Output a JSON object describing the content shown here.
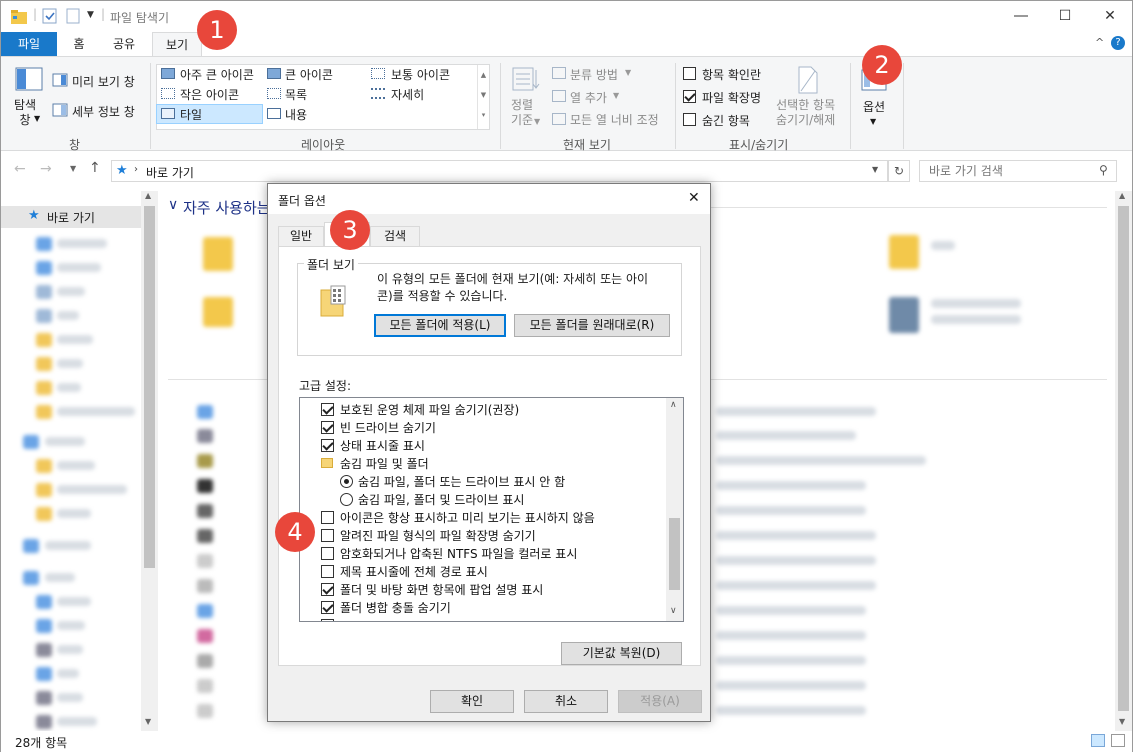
{
  "window": {
    "title": "파일 탐색기",
    "status": "28개 항목"
  },
  "tabs": [
    {
      "label": "파일"
    },
    {
      "label": "홈"
    },
    {
      "label": "공유"
    },
    {
      "label": "보기"
    }
  ],
  "ribbon": {
    "pane": {
      "nav_pane_label": "탐색\n창",
      "preview": "미리 보기 창",
      "details": "세부 정보 창",
      "group": "창"
    },
    "layout": {
      "items": [
        "아주 큰 아이콘",
        "큰 아이콘",
        "보통 아이콘",
        "작은 아이콘",
        "목록",
        "자세히",
        "타일",
        "내용"
      ],
      "group": "레이아웃"
    },
    "current_view": {
      "sort": "정렬\n기준",
      "group_by": "분류 방법",
      "add_column": "열 추가",
      "fit_columns": "모든 열 너비 조정",
      "group": "현재 보기"
    },
    "show_hide": {
      "item_checkbox": "항목 확인란",
      "file_ext": "파일 확장명",
      "hidden_items": "숨긴 항목",
      "hide_selected": "선택한 항목\n숨기기/해제",
      "group": "표시/숨기기"
    },
    "options": "옵션"
  },
  "address": {
    "path": "바로 가기",
    "search_placeholder": "바로 가기 검색"
  },
  "nav": {
    "quick_access": "바로 가기"
  },
  "content": {
    "frequent_header": "자주 사용하는"
  },
  "dialog": {
    "title": "폴더 옵션",
    "tabs": [
      "일반",
      "보기",
      "검색"
    ],
    "folder_view": {
      "legend": "폴더 보기",
      "desc": "이 유형의 모든 폴더에 현재 보기(예: 자세히 또는 아이\n콘)를 적용할 수 있습니다.",
      "apply_all": "모든 폴더에 적용(L)",
      "reset_all": "모든 폴더를 원래대로(R)"
    },
    "advanced_label": "고급 설정:",
    "settings": [
      {
        "label": "보호된 운영 체제 파일 숨기기(권장)",
        "type": "checkbox",
        "checked": true
      },
      {
        "label": "빈 드라이브 숨기기",
        "type": "checkbox",
        "checked": true
      },
      {
        "label": "상태 표시줄 표시",
        "type": "checkbox",
        "checked": true
      },
      {
        "label": "숨김 파일 및 폴더",
        "type": "folder",
        "checked": false
      },
      {
        "label": "숨김 파일, 폴더 또는 드라이브 표시 안 함",
        "type": "radio",
        "checked": true
      },
      {
        "label": "숨김 파일, 폴더 및 드라이브 표시",
        "type": "radio",
        "checked": false
      },
      {
        "label": "아이콘은 항상 표시하고 미리 보기는 표시하지 않음",
        "type": "checkbox",
        "checked": false
      },
      {
        "label": "알려진 파일 형식의 파일 확장명 숨기기",
        "type": "checkbox",
        "checked": false
      },
      {
        "label": "암호화되거나 압축된 NTFS 파일을 컬러로 표시",
        "type": "checkbox",
        "checked": false
      },
      {
        "label": "제목 표시줄에 전체 경로 표시",
        "type": "checkbox",
        "checked": false
      },
      {
        "label": "폴더 및 바탕 화면 항목에 팝업 설명 표시",
        "type": "checkbox",
        "checked": true
      },
      {
        "label": "폴더 병합 충돌 숨기기",
        "type": "checkbox",
        "checked": true
      }
    ],
    "restore_defaults": "기본값 복원(D)",
    "ok": "확인",
    "cancel": "취소",
    "apply": "적용(A)"
  },
  "badges": [
    "1",
    "2",
    "3",
    "4"
  ],
  "colors": {
    "file_tab": "#1979ca",
    "badge": "#e8473b",
    "ribbon_bg": "#f5f6f7",
    "dialog_bg": "#f0f0f0",
    "selection": "#cce8ff"
  }
}
